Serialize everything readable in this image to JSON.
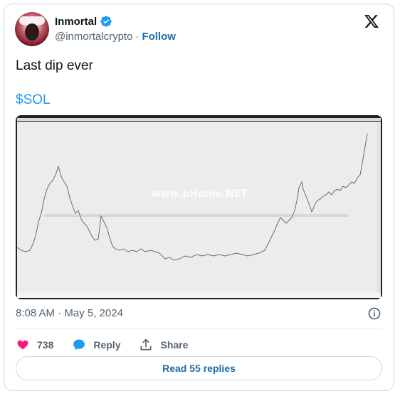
{
  "author": {
    "display_name": "Inmortal",
    "handle": "@inmortalcrypto",
    "separator": "·",
    "follow_label": "Follow",
    "verified": true
  },
  "tweet": {
    "text": "Last dip ever",
    "cashtag": "$SOL",
    "timestamp": "8:08 AM · May 5, 2024"
  },
  "media": {
    "watermark": "www.pHome.NET"
  },
  "actions": {
    "likes_count": "738",
    "reply_label": "Reply",
    "share_label": "Share"
  },
  "replies_button_label": "Read 55 replies",
  "colors": {
    "accent_blue": "#1d9bf0",
    "link_blue": "#1d6ca6",
    "like_pink": "#f91880",
    "muted_text": "#536471"
  }
}
